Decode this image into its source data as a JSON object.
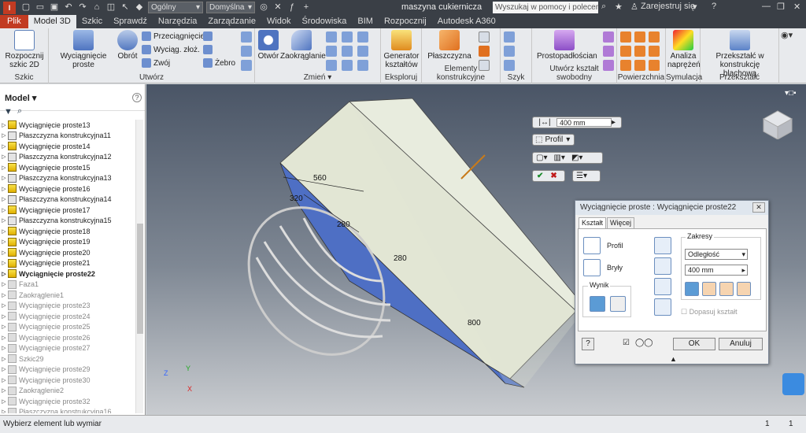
{
  "qat": {
    "style_dropdown": "Ogólny",
    "color_dropdown": "Domyślna",
    "title": "maszyna cukiernicza",
    "search_placeholder": "Wyszukaj w pomocy i polecenia...",
    "signin": "Zarejestruj się"
  },
  "tabs": [
    "Plik",
    "Model 3D",
    "Szkic",
    "Sprawdź",
    "Narzędzia",
    "Zarządzanie",
    "Widok",
    "Środowiska",
    "BIM",
    "Rozpocznij",
    "Autodesk A360"
  ],
  "ribbon": {
    "szkic": {
      "start": "Rozpocznij szkic 2D",
      "label": "Szkic"
    },
    "utworz": {
      "extrude": "Wyciągnięcie proste",
      "revolve": "Obrót",
      "sweep": "Przeciągnięcie",
      "loft": "Wyciąg. złoż.",
      "coil": "Zwój",
      "rib": "Żebro",
      "label": "Utwórz"
    },
    "zmien": {
      "hole": "Otwór",
      "fillet": "Zaokrąglanie",
      "label": "Zmień"
    },
    "eksploruj": {
      "generator": "Generator kształtów",
      "label": "Eksploruj"
    },
    "elementy": {
      "plane": "Płaszczyzna",
      "label": "Elementy konstrukcyjne"
    },
    "szyk": {
      "label": "Szyk"
    },
    "utworz_ksztalt": {
      "box": "Prostopadłościan",
      "label": "Utwórz kształt swobodny"
    },
    "powierzchnia": {
      "label": "Powierzchnia"
    },
    "symulacja": {
      "stress": "Analiza naprężeń",
      "label": "Symulacja"
    },
    "przeksztalc": {
      "convert": "Przekształć w konstrukcję blachową",
      "label": "Przekształć"
    }
  },
  "browser": {
    "title": "Model",
    "items": [
      {
        "label": "Wyciągnięcie proste13",
        "kind": "ext",
        "style": "normal"
      },
      {
        "label": "Płaszczyzna konstrukcyjna11",
        "kind": "pl",
        "style": "normal"
      },
      {
        "label": "Wyciągnięcie proste14",
        "kind": "ext",
        "style": "normal"
      },
      {
        "label": "Płaszczyzna konstrukcyjna12",
        "kind": "pl",
        "style": "normal"
      },
      {
        "label": "Wyciągnięcie proste15",
        "kind": "ext",
        "style": "normal"
      },
      {
        "label": "Płaszczyzna konstrukcyjna13",
        "kind": "pl",
        "style": "normal"
      },
      {
        "label": "Wyciągnięcie proste16",
        "kind": "ext",
        "style": "normal"
      },
      {
        "label": "Płaszczyzna konstrukcyjna14",
        "kind": "pl",
        "style": "normal"
      },
      {
        "label": "Wyciągnięcie proste17",
        "kind": "ext",
        "style": "normal"
      },
      {
        "label": "Płaszczyzna konstrukcyjna15",
        "kind": "pl",
        "style": "normal"
      },
      {
        "label": "Wyciągnięcie proste18",
        "kind": "ext",
        "style": "normal"
      },
      {
        "label": "Wyciągnięcie proste19",
        "kind": "ext",
        "style": "normal"
      },
      {
        "label": "Wyciągnięcie proste20",
        "kind": "ext",
        "style": "normal"
      },
      {
        "label": "Wyciągnięcie proste21",
        "kind": "ext",
        "style": "normal"
      },
      {
        "label": "Wyciągnięcie proste22",
        "kind": "ext",
        "style": "bold"
      },
      {
        "label": "Faza1",
        "kind": "dimi",
        "style": "dim"
      },
      {
        "label": "Zaokrąglenie1",
        "kind": "dimi",
        "style": "dim"
      },
      {
        "label": "Wyciągnięcie proste23",
        "kind": "dimi",
        "style": "dim"
      },
      {
        "label": "Wyciągnięcie proste24",
        "kind": "dimi",
        "style": "dim"
      },
      {
        "label": "Wyciągnięcie proste25",
        "kind": "dimi",
        "style": "dim"
      },
      {
        "label": "Wyciągnięcie proste26",
        "kind": "dimi",
        "style": "dim"
      },
      {
        "label": "Wyciągnięcie proste27",
        "kind": "dimi",
        "style": "dim"
      },
      {
        "label": "Szkic29",
        "kind": "dimi",
        "style": "dim"
      },
      {
        "label": "Wyciągnięcie proste29",
        "kind": "dimi",
        "style": "dim"
      },
      {
        "label": "Wyciągnięcie proste30",
        "kind": "dimi",
        "style": "dim"
      },
      {
        "label": "Zaokrąglenie2",
        "kind": "dimi",
        "style": "dim"
      },
      {
        "label": "Wyciągnięcie proste32",
        "kind": "dimi",
        "style": "dim"
      },
      {
        "label": "Płaszczyzna konstrukcyjna16",
        "kind": "dimi",
        "style": "dim"
      }
    ]
  },
  "viewport": {
    "dims": [
      "560",
      "320",
      "280",
      "280",
      "800"
    ],
    "minitoolbar_value": "400 mm",
    "minitoolbar_profile": "Profil",
    "triad": {
      "x": "X",
      "y": "Y",
      "z": "Z"
    }
  },
  "dialog": {
    "title": "Wyciągnięcie proste : Wyciągnięcie proste22",
    "tab_shape": "Kształt",
    "tab_more": "Więcej",
    "profile": "Profil",
    "solids": "Bryły",
    "output": "Wynik",
    "extents": "Zakresy",
    "extents_type": "Odległość",
    "distance": "400 mm",
    "match_shape": "Dopasuj kształt",
    "ok": "OK",
    "cancel": "Anuluj"
  },
  "status": {
    "message": "Wybierz element lub wymiar",
    "count1": "1",
    "count2": "1"
  },
  "colors": {
    "accent": "#c23b22",
    "face_blue": "#4e6fc4",
    "body": "#e2e6d4"
  }
}
